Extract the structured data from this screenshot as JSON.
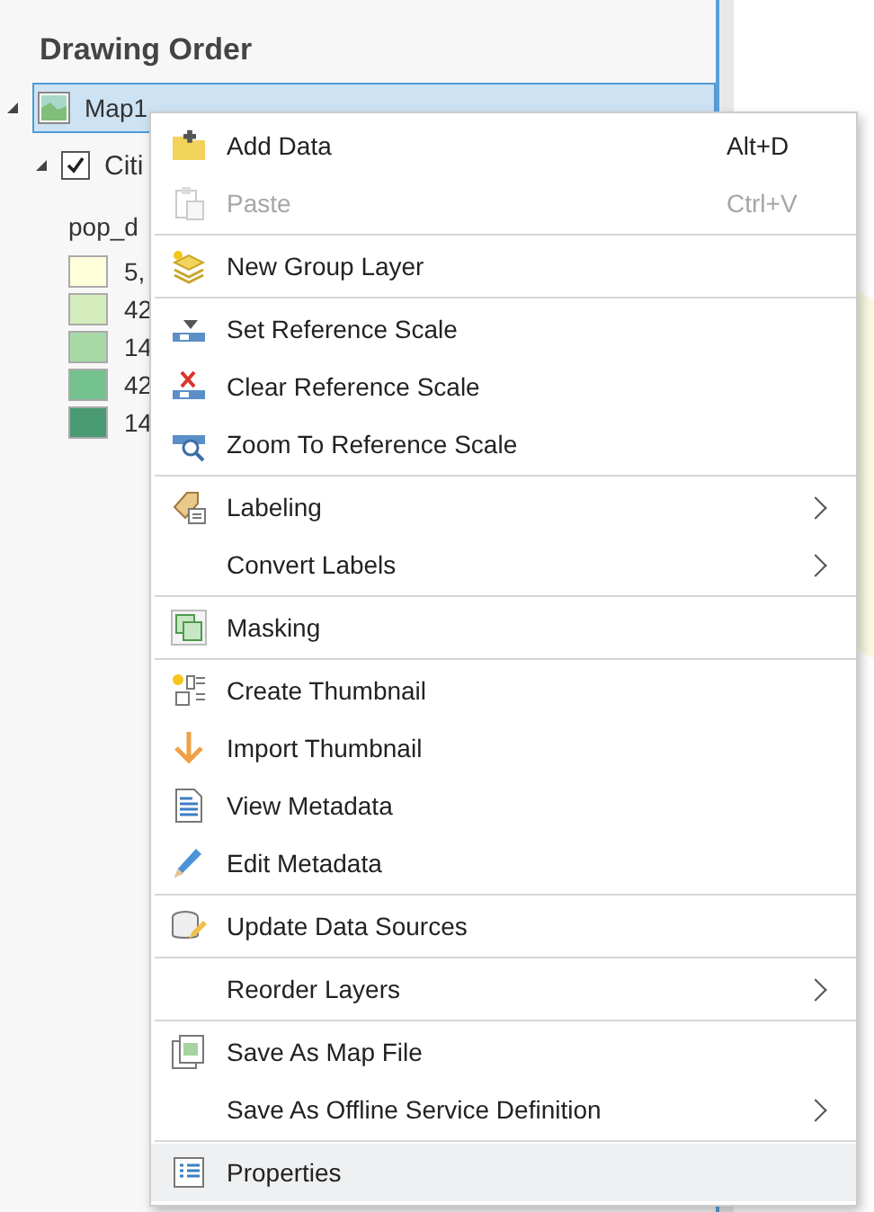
{
  "panel": {
    "title": "Drawing Order",
    "tree": [
      {
        "label": "Map1",
        "selected": true,
        "expanded": true,
        "children": [
          {
            "label": "Citi",
            "checked": true,
            "expanded": true,
            "field": "pop_d",
            "legend": [
              {
                "label": "5,",
                "color": "#fefedb"
              },
              {
                "label": "42",
                "color": "#d5ecbd"
              },
              {
                "label": "14",
                "color": "#a8d9a6"
              },
              {
                "label": "42",
                "color": "#74c28d"
              },
              {
                "label": "14",
                "color": "#4a9a72"
              }
            ]
          }
        ]
      }
    ]
  },
  "context_menu": {
    "groups": [
      [
        {
          "label": "Add Data",
          "shortcut": "Alt+D",
          "submenu": false,
          "disabled": false,
          "selected": false
        },
        {
          "label": "Paste",
          "shortcut": "Ctrl+V",
          "submenu": false,
          "disabled": true,
          "selected": false
        }
      ],
      [
        {
          "label": "New Group Layer",
          "submenu": false,
          "disabled": false,
          "selected": false
        }
      ],
      [
        {
          "label": "Set Reference Scale",
          "submenu": false,
          "disabled": false,
          "selected": false
        },
        {
          "label": "Clear Reference Scale",
          "submenu": false,
          "disabled": false,
          "selected": false
        },
        {
          "label": "Zoom To Reference Scale",
          "submenu": false,
          "disabled": false,
          "selected": false
        }
      ],
      [
        {
          "label": "Labeling",
          "submenu": true,
          "disabled": false,
          "selected": false
        },
        {
          "label": "Convert Labels",
          "submenu": true,
          "disabled": false,
          "selected": false
        }
      ],
      [
        {
          "label": "Masking",
          "submenu": false,
          "disabled": false,
          "selected": false
        }
      ],
      [
        {
          "label": "Create Thumbnail",
          "submenu": false,
          "disabled": false,
          "selected": false
        },
        {
          "label": "Import Thumbnail",
          "submenu": false,
          "disabled": false,
          "selected": false
        },
        {
          "label": "View Metadata",
          "submenu": false,
          "disabled": false,
          "selected": false
        },
        {
          "label": "Edit Metadata",
          "submenu": false,
          "disabled": false,
          "selected": false
        }
      ],
      [
        {
          "label": "Update Data Sources",
          "submenu": false,
          "disabled": false,
          "selected": false
        }
      ],
      [
        {
          "label": "Reorder Layers",
          "submenu": true,
          "disabled": false,
          "selected": false
        }
      ],
      [
        {
          "label": "Save As Map File",
          "submenu": false,
          "disabled": false,
          "selected": false
        },
        {
          "label": "Save As Offline Service Definition",
          "submenu": true,
          "disabled": false,
          "selected": false
        }
      ],
      [
        {
          "label": "Properties",
          "submenu": false,
          "disabled": false,
          "selected": true
        }
      ]
    ]
  }
}
